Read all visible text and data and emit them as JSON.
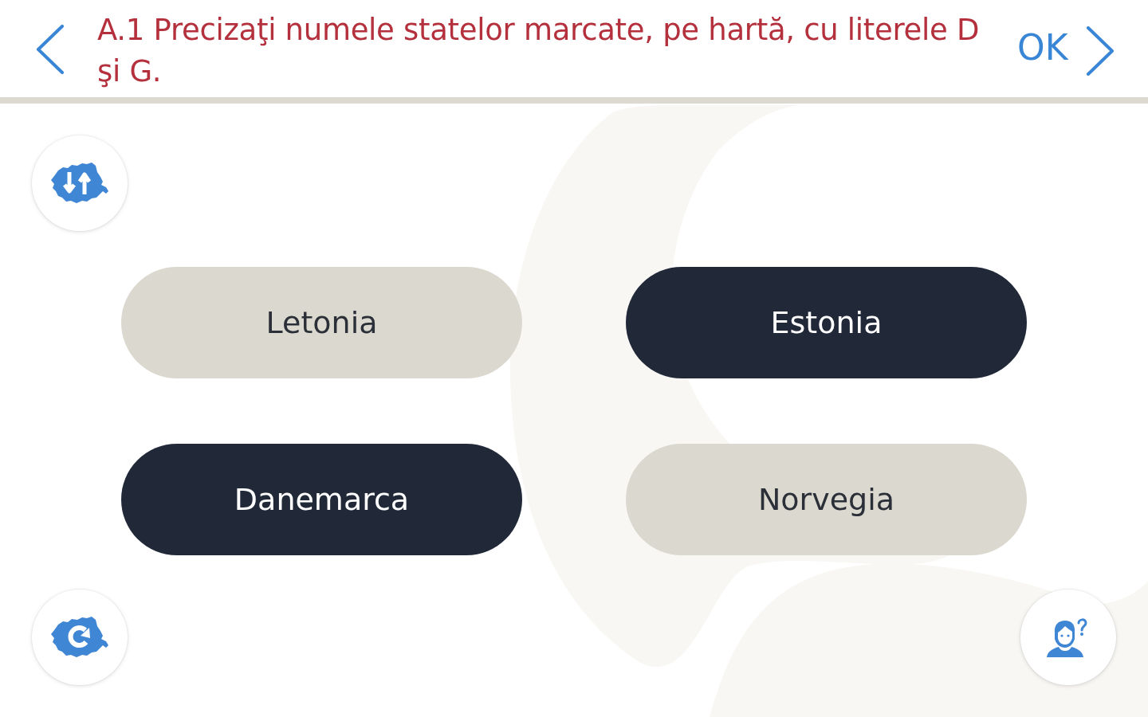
{
  "header": {
    "question": "A.1 Precizaţi numele statelor marcate, pe hartă, cu literele D şi G.",
    "confirm": "OK"
  },
  "options": [
    {
      "label": "Letonia",
      "selected": false
    },
    {
      "label": "Estonia",
      "selected": true
    },
    {
      "label": "Danemarca",
      "selected": true
    },
    {
      "label": "Norvegia",
      "selected": false
    }
  ]
}
